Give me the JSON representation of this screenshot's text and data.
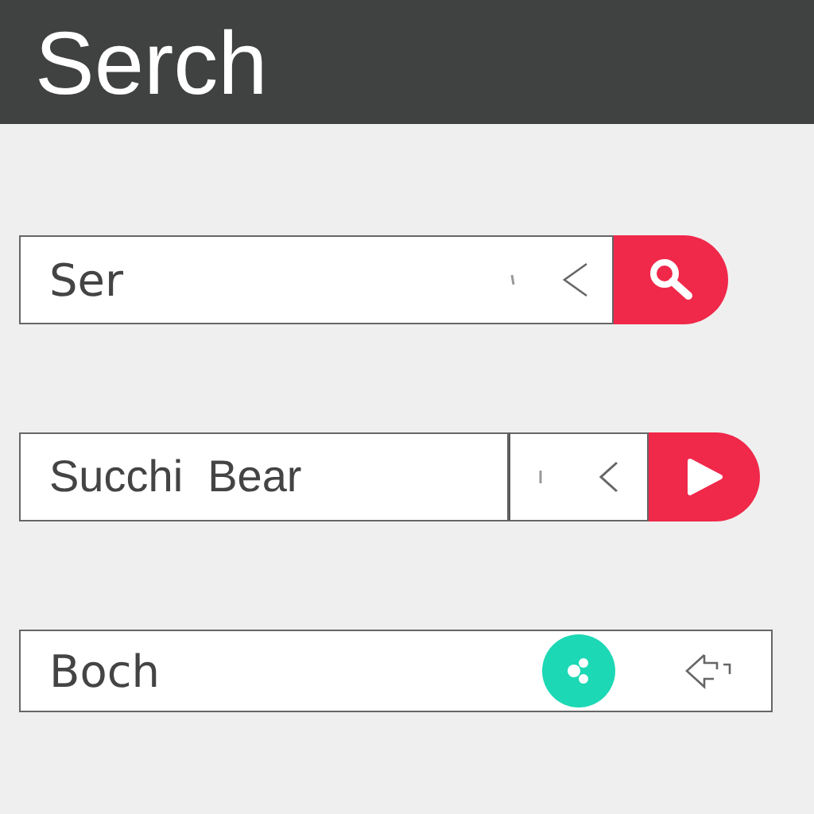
{
  "header": {
    "title": "Serch"
  },
  "search_bars": [
    {
      "kind": "search",
      "value": "Ser"
    },
    {
      "kind": "play",
      "value": "Succhi  Bear"
    },
    {
      "kind": "share",
      "value": "Boch"
    }
  ]
}
